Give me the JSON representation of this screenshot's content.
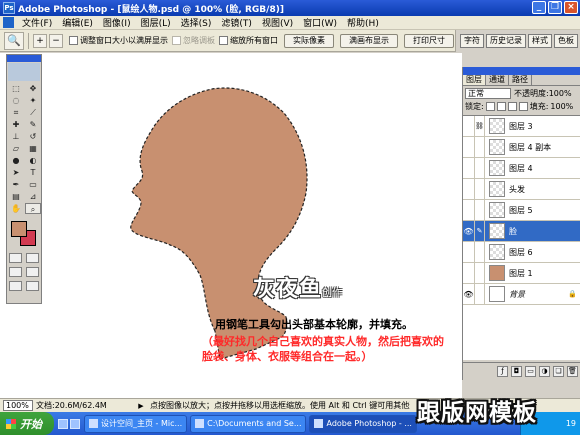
{
  "window": {
    "title": "Adobe Photoshop - [鼠绘人物.psd @ 100% (脸, RGB/8)]"
  },
  "menu": [
    "文件(F)",
    "编辑(E)",
    "图像(I)",
    "图层(L)",
    "选择(S)",
    "滤镜(T)",
    "视图(V)",
    "窗口(W)",
    "帮助(H)"
  ],
  "options": {
    "tool_icon": "zoom-icon",
    "check_resize": "调整窗口大小以满屏显示",
    "check_ignore": "忽略调板",
    "check_all": "缩放所有窗口",
    "btn_actual": "实际像素",
    "btn_fit": "满画布显示",
    "btn_print": "打印尺寸"
  },
  "palette_well": [
    "字符",
    "历史记录",
    "样式",
    "色板"
  ],
  "canvas": {
    "logo_text": "灰夜鱼",
    "logo_suffix": "创作",
    "note_line1": "用钢笔工具勾出头部基本轮廓，并填充。",
    "note_line2": "（最好找几个自己喜欢的真实人物，然后把喜欢的脸袋、身体、衣服等组合在一起。）"
  },
  "colors": {
    "skin_fill": "#c89070",
    "foreground": "#c89070",
    "background_swatch": "#d33b52",
    "note_red": "#ff2a2a",
    "selected_row": "#316ac5"
  },
  "layers_panel": {
    "tabs": [
      "图层",
      "通道",
      "路径"
    ],
    "blend_mode": "正常",
    "opacity_label": "不透明度:",
    "opacity_value": "100%",
    "lock_label": "锁定:",
    "fill_label": "填充:",
    "fill_value": "100%",
    "layers": [
      {
        "name": "图层 3",
        "visible": false,
        "selected": false
      },
      {
        "name": "图层 4 副本",
        "visible": false,
        "selected": false
      },
      {
        "name": "图层 4",
        "visible": false,
        "selected": false
      },
      {
        "name": "头发",
        "visible": false,
        "selected": false
      },
      {
        "name": "图层 5",
        "visible": false,
        "selected": false
      },
      {
        "name": "脸",
        "visible": true,
        "selected": true
      },
      {
        "name": "图层 6",
        "visible": false,
        "selected": false
      },
      {
        "name": "图层 1",
        "visible": false,
        "selected": false
      },
      {
        "name": "背景",
        "visible": true,
        "selected": false
      }
    ]
  },
  "status": {
    "zoom": "100%",
    "doc": "文档:20.6M/62.4M",
    "hint": "点按图像以放大；点按并拖移以用选框缩放。使用 Alt 和 Ctrl 键可用其他选项。"
  },
  "taskbar": {
    "start": "开始",
    "tasks": [
      "设计空间_主页 - Mic...",
      "C:\\Documents and Se...",
      "Adobe Photoshop - ..."
    ],
    "clock": "19"
  },
  "watermark": "跟版网模板"
}
